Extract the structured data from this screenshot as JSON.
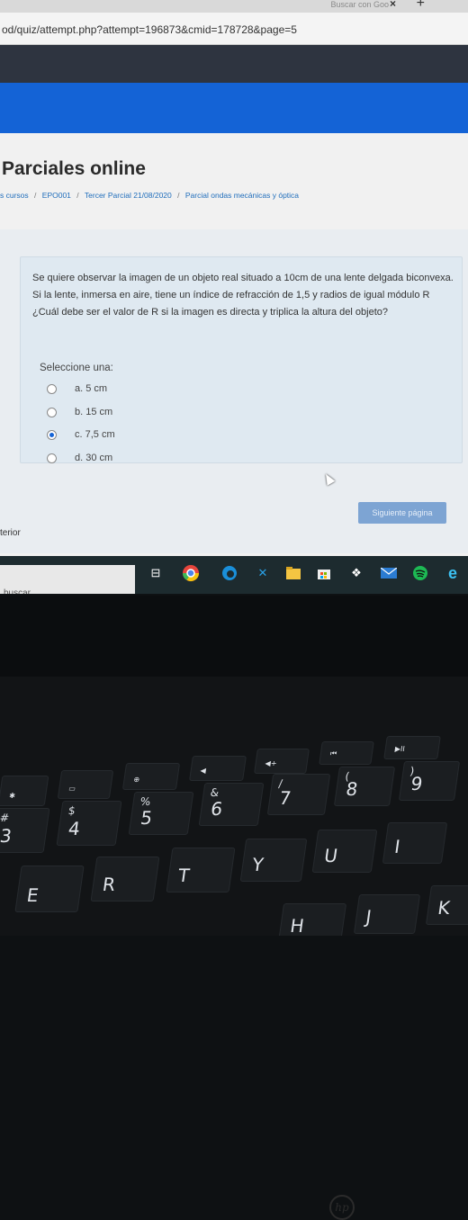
{
  "browser": {
    "tab_title": "Buscar con Goo",
    "tab_close": "×",
    "new_tab": "+",
    "url": "od/quiz/attempt.php?attempt=196873&cmid=178728&page=5"
  },
  "page": {
    "title": "Parciales online",
    "breadcrumb": [
      "s cursos",
      "EPO001",
      "Tercer Parcial 21/08/2020",
      "Parcial ondas mecánicas y óptica"
    ],
    "breadcrumb_sep": "/"
  },
  "question": {
    "text": "Se quiere observar la imagen de un objeto real situado a 10cm de una lente delgada biconvexa. Si la lente, inmersa en aire, tiene un índice de refracción de 1,5 y radios de igual módulo R ¿Cuál debe ser el valor de R si la imagen es directa y triplica la altura del objeto?",
    "select_label": "Seleccione una:",
    "options": [
      {
        "label": "a. 5 cm",
        "checked": false
      },
      {
        "label": "b. 15 cm",
        "checked": false
      },
      {
        "label": "c. 7,5 cm",
        "checked": true
      },
      {
        "label": "d. 30 cm",
        "checked": false
      }
    ]
  },
  "navigation": {
    "next_label": "Siguiente página",
    "prev_label": "terior"
  },
  "taskbar": {
    "search_text": "buscar",
    "icons": [
      "task-view-icon",
      "chrome-icon",
      "edge-icon",
      "vscode-icon",
      "explorer-icon",
      "store-icon",
      "dropbox-icon",
      "mail-icon",
      "spotify-icon",
      "edge-legacy-icon"
    ]
  },
  "laptop": {
    "logo": "hp",
    "keys_row_fn": [
      "✱",
      "▭",
      "⊕",
      "◀",
      "◀+",
      "⏮",
      "▶II"
    ],
    "keys_row_num": [
      {
        "top": "#",
        "main": "3"
      },
      {
        "top": "$",
        "main": "4"
      },
      {
        "top": "%",
        "main": "5"
      },
      {
        "top": "&",
        "main": "6"
      },
      {
        "top": "/",
        "main": "7"
      },
      {
        "top": "(",
        "main": "8"
      },
      {
        "top": ")",
        "main": "9"
      }
    ],
    "keys_row_qwerty": [
      "E",
      "R",
      "T",
      "Y",
      "U",
      "I"
    ],
    "keys_row_home": [
      "H",
      "J",
      "K"
    ]
  },
  "colors": {
    "accent": "#1463d6",
    "header_dark": "#2e3440",
    "question_bg": "#dfe9f1",
    "button_bg": "#7da4d3"
  }
}
